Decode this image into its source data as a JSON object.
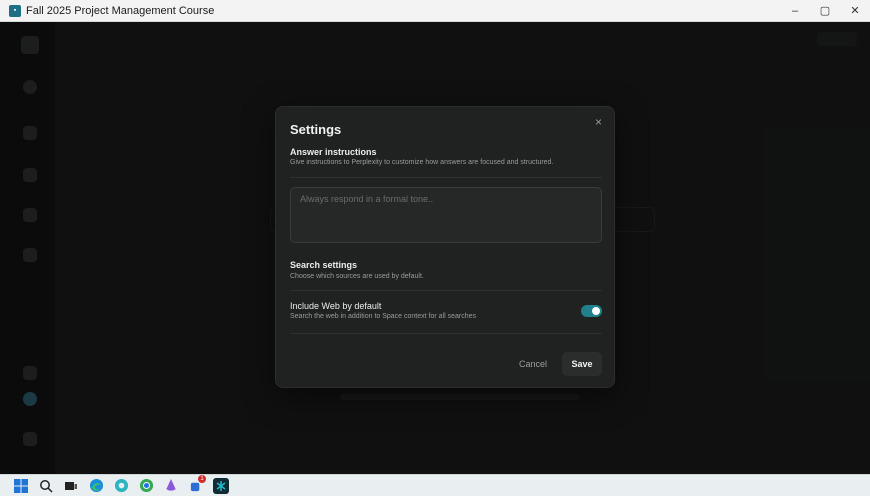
{
  "window": {
    "title": "Fall 2025 Project Management Course",
    "minimize": "–",
    "maximize": "▢",
    "close": "✕"
  },
  "modal": {
    "title": "Settings",
    "close": "×",
    "answer_instructions": {
      "title": "Answer instructions",
      "description": "Give instructions to Perplexity to customize how answers are focused and structured.",
      "placeholder": "Always respond in a formal tone..",
      "value": ""
    },
    "search_settings": {
      "title": "Search settings",
      "description": "Choose which sources are used by default."
    },
    "include_web": {
      "title": "Include Web by default",
      "description": "Search the web in addition to Space context for all searches",
      "enabled": true
    },
    "cancel_label": "Cancel",
    "save_label": "Save"
  },
  "colors": {
    "accent": "#20808d",
    "modal_bg": "#202222",
    "app_bg": "#191a1a"
  },
  "taskbar": {
    "icons": [
      "windows-start-icon",
      "search-icon",
      "task-view-icon",
      "edge-icon",
      "chrome-canary-icon",
      "chrome-icon",
      "copilot-icon",
      "app-notification-icon",
      "perplexity-icon"
    ],
    "badge_count": "1"
  }
}
